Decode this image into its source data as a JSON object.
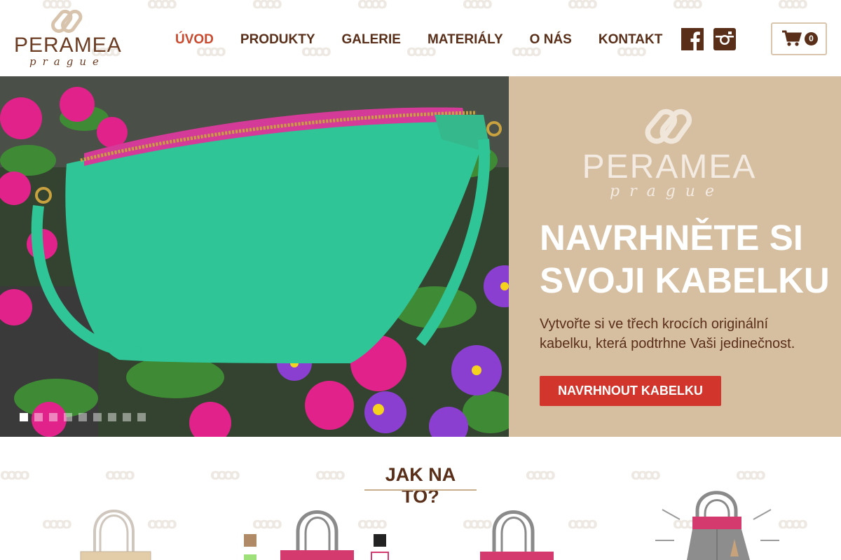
{
  "brand": {
    "name": "PERAMEA",
    "sub": "prague"
  },
  "nav": {
    "items": [
      {
        "label": "ÚVOD",
        "active": true
      },
      {
        "label": "PRODUKTY",
        "active": false
      },
      {
        "label": "GALERIE",
        "active": false
      },
      {
        "label": "MATERIÁLY",
        "active": false
      },
      {
        "label": "O NÁS",
        "active": false
      },
      {
        "label": "KONTAKT",
        "active": false
      }
    ]
  },
  "social": {
    "facebook_icon": "facebook-icon",
    "instagram_icon": "instagram-icon"
  },
  "cart": {
    "icon": "cart-icon",
    "count": "0"
  },
  "hero": {
    "panel_logo_name": "PERAMEA",
    "panel_logo_sub": "prague",
    "title": "NAVRHNĚTE SI SVOJI KABELKU",
    "text": "Vytvořte si ve třech krocích originální kabelku, která podtrhne Vaši jedinečnost.",
    "button_label": "NAVRHNOUT KABELKU",
    "slide_count": 9,
    "active_slide": 1
  },
  "howto": {
    "title": "JAK NA TO?"
  },
  "colors": {
    "brand_brown": "#5a2f1a",
    "accent_red": "#d1352b",
    "active_nav": "#c94a2e",
    "panel_beige": "#d6bea1",
    "bag_green": "#2fc596"
  }
}
